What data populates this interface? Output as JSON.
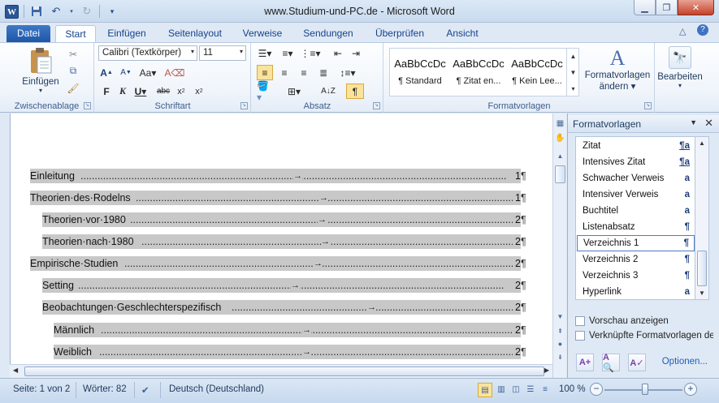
{
  "window": {
    "title": "www.Studium-und-PC.de  -  Microsoft Word"
  },
  "tabs": [
    "Datei",
    "Start",
    "Einfügen",
    "Seitenlayout",
    "Verweise",
    "Sendungen",
    "Überprüfen",
    "Ansicht"
  ],
  "ribbon": {
    "clipboard": {
      "label": "Zwischenablage",
      "paste": "Einfügen"
    },
    "font": {
      "label": "Schriftart",
      "name": "Calibri (Textkörper)",
      "size": "11"
    },
    "paragraph": {
      "label": "Absatz"
    },
    "styles": {
      "label": "Formatvorlagen",
      "tiles": [
        {
          "sample": "AaBbCcDc",
          "name": "¶ Standard"
        },
        {
          "sample": "AaBbCcDc",
          "name": "¶ Zitat en..."
        },
        {
          "sample": "AaBbCcDc",
          "name": "¶ Kein Lee..."
        }
      ],
      "change_label_1": "Formatvorlagen",
      "change_label_2": "ändern ▾"
    },
    "editing": {
      "label": "Bearbeiten"
    }
  },
  "document": {
    "toc": [
      {
        "text": "Einleitung",
        "page": "1"
      },
      {
        "text": "Theorien·des·Rodelns",
        "page": "1"
      },
      {
        "text": "Theorien·vor·1980",
        "page": "2"
      },
      {
        "text": "Theorien·nach·1980 ",
        "page": "2"
      },
      {
        "text": "Empirische·Studien",
        "page": "2"
      },
      {
        "text": "Setting",
        "page": "2"
      },
      {
        "text": "Beobachtungen·Geschlechterspezifisch",
        "page": "2"
      },
      {
        "text": "Männlich ",
        "page": "2"
      },
      {
        "text": "Weiblich ",
        "page": "2"
      }
    ],
    "pilcrow": "¶"
  },
  "styles_pane": {
    "title": "Formatvorlagen",
    "items": [
      {
        "name": "Zitat",
        "symbol": "¶a"
      },
      {
        "name": "Intensives Zitat",
        "symbol": "¶a"
      },
      {
        "name": "Schwacher Verweis",
        "symbol": "a"
      },
      {
        "name": "Intensiver Verweis",
        "symbol": "a"
      },
      {
        "name": "Buchtitel",
        "symbol": "a"
      },
      {
        "name": "Listenabsatz",
        "symbol": "¶"
      },
      {
        "name": "Verzeichnis 1",
        "symbol": "¶"
      },
      {
        "name": "Verzeichnis 2",
        "symbol": "¶"
      },
      {
        "name": "Verzeichnis 3",
        "symbol": "¶"
      },
      {
        "name": "Hyperlink",
        "symbol": "a"
      }
    ],
    "selected_index": 6,
    "preview_label": "Vorschau anzeigen",
    "linked_label": "Verknüpfte Formatvorlagen dea",
    "options_link": "Optionen..."
  },
  "status": {
    "page": "Seite: 1 von 2",
    "words": "Wörter: 82",
    "language": "Deutsch (Deutschland)",
    "zoom": "100 %"
  }
}
